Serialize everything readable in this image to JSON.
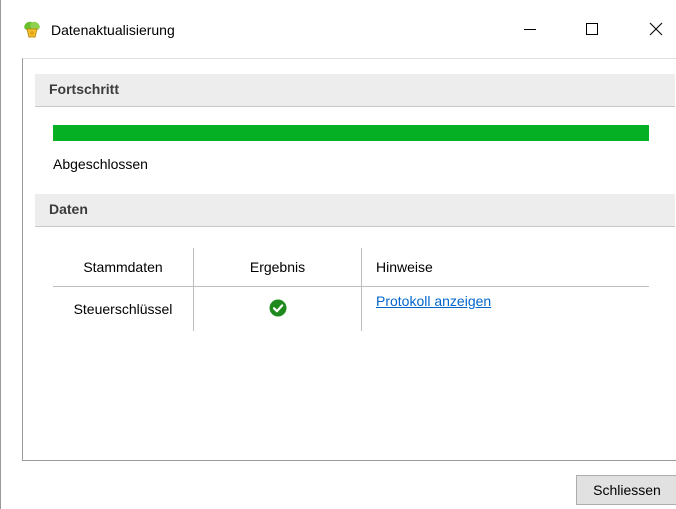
{
  "window": {
    "title": "Datenaktualisierung",
    "icon": "leaf-app-icon",
    "controls": [
      "minimize-icon",
      "maximize-icon",
      "close-icon"
    ]
  },
  "progress_section": {
    "header": "Fortschritt",
    "progress_fraction": 1.0,
    "progress_color": "#06b025",
    "status": "Abgeschlossen"
  },
  "data_section": {
    "header": "Daten",
    "columns": [
      "Stammdaten",
      "Ergebnis",
      "Hinweise"
    ],
    "rows": [
      {
        "name": "Steuerschlüssel",
        "result_icon": "check-circle-icon",
        "result_color": "#1e8a1e",
        "note_link": "Protokoll anzeigen"
      }
    ]
  },
  "footer": {
    "close_label": "Schliessen"
  }
}
